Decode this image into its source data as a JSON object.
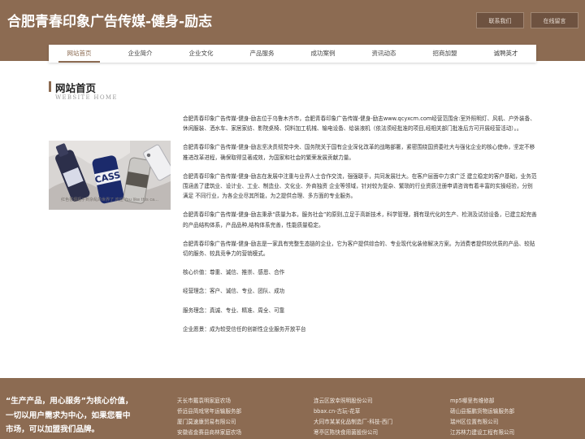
{
  "header": {
    "title": "合肥青春印象广告传媒-健身-励志",
    "contact_label": "联系我们",
    "message_label": "在线留言"
  },
  "nav": {
    "items": [
      "网站首页",
      "企业简介",
      "企业文化",
      "产品服务",
      "成功案例",
      "资讯动态",
      "招商加盟",
      "诚聘英才"
    ]
  },
  "section": {
    "title": "网站首页",
    "subtitle": "WEBSITE HOME"
  },
  "photo": {
    "brand_text": "CASS",
    "caption": "红色香烟瓶子到杂乱的世界了 欢迎\nYou like this ca..."
  },
  "content": {
    "paragraphs": [
      "合肥青春印象广告传媒-健身-励志位于乌鲁木齐市，合肥青春印象广告传媒-健身-励志www.qcyxcm.com经营范围含:室外照明灯、风机、户外装备、休闲服装、洒水车、家居家纺、影院桌椅、饲料加工机械、输电设备、给装液机（依法须经批准的项目,经相关部门批准后方可开展经营活动）。。",
      "合肥青春印象广告传媒-健身-励志坚决贯彻党中央、国务院关于国有企业深化改革的战略部署，紧密围绕国资委社大与强化企业的核心使命，坚定不移推进改革进程，确保取得显著成效，为国家和社会的繁荣发展贡献力量。",
      "合肥青春印象广告传媒-健身-励志在发展中注重与业界人士合作交流，强强联手，共同发展壮大。在客户层面中力求广泛 建立稳定的客户基础，业务范围涵盖了建筑业、设计业、工业、制造业、文化业、外商独资 企业等领域，针对较为复杂、繁琐的行业资质注册申请咨询有着丰富的实操经验，分别满足 不同行业，为各企业尽其所能，为之提供合理、多方面的专业服务。",
      "合肥青春印象广告传媒-健身-励志秉承“质量为本，服务社会”的原则,立足于高新技术，科学管理，拥有现代化的生产、检测及试验设备，已建立起完善的产品结构体系，产品品种,结构体系完善，性能质量稳定。",
      "合肥青春印象广告传媒-健身-励志是一家具有完整生态链的企业，它为客户提供综合的、专业现代化装修解决方案。为消费者提供较优质的产品、较贴切的服务、较具竞争力的营销模式。",
      "核心价值：尊重、诚信、推崇、感恩、合作",
      "经营理念：客户、诚信、专业、团队、成功",
      "服务理念：真诚、专业、精准、周全、可靠",
      "企业愿景：成为较受信任的创新性企业服务开放平台"
    ]
  },
  "footer": {
    "slogan": "“生产产品，用心服务”为核心价值，一切以用户需求为中心，如果您看中市场，可以加盟我们品牌。",
    "links": [
      "天长市戴袁明家庭农场",
      "侨远县简戏常年运输服务部",
      "厦门莫速康贸易有限公司",
      "安徽省金赛县商林家庭农场",
      "连云区放幸照明股份公司",
      "bbax.cn-古玩-花草",
      "大同市某某化品制造厂-科技-西门",
      "寒亭区陈快食用菌股份公司",
      "mp5哪里有维修部",
      "砀山县振鹏货物运输服务部",
      "瑞州区位置有限公司",
      "江苏林力建设工程有限公司"
    ]
  },
  "colors": {
    "brand": "#8c6b52",
    "button": "#6e5240"
  }
}
